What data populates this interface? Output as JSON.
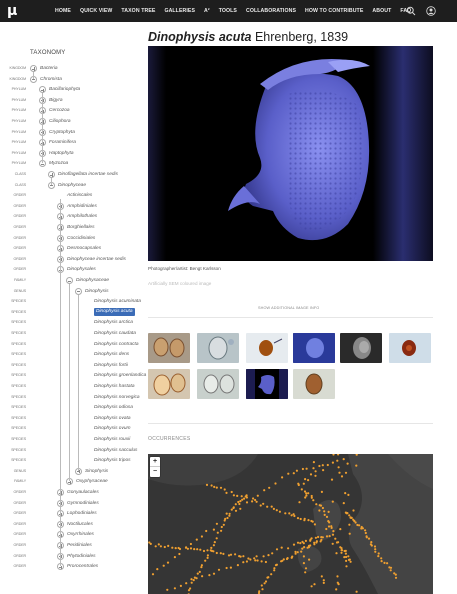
{
  "nav": {
    "logo": "μ",
    "items": [
      "HOME",
      "QUICK VIEW",
      "TAXON TREE",
      "GALLERIES",
      "A²",
      "TOOLS",
      "COLLABORATIONS",
      "HOW TO CONTRIBUTE",
      "ABOUT",
      "FAQ"
    ]
  },
  "sidebar": {
    "title": "TAXONOMY",
    "rows": [
      {
        "rank": "KINGDOM",
        "name": "Bacteria",
        "depth": 0,
        "toggle": "plus"
      },
      {
        "rank": "KINGDOM",
        "name": "Chromista",
        "depth": 0,
        "toggle": "minus"
      },
      {
        "rank": "PHYLUM",
        "name": "Bacillariophyta",
        "depth": 1,
        "toggle": "plus"
      },
      {
        "rank": "PHYLUM",
        "name": "Bigyra",
        "depth": 1,
        "toggle": "plus"
      },
      {
        "rank": "PHYLUM",
        "name": "Cercozoa",
        "depth": 1,
        "toggle": "plus"
      },
      {
        "rank": "PHYLUM",
        "name": "Ciliophora",
        "depth": 1,
        "toggle": "plus"
      },
      {
        "rank": "PHYLUM",
        "name": "Cryptophyta",
        "depth": 1,
        "toggle": "plus"
      },
      {
        "rank": "PHYLUM",
        "name": "Foraminifera",
        "depth": 1,
        "toggle": "plus"
      },
      {
        "rank": "PHYLUM",
        "name": "Haptophyta",
        "depth": 1,
        "toggle": "plus"
      },
      {
        "rank": "PHYLUM",
        "name": "Myzozoa",
        "depth": 1,
        "toggle": "minus"
      },
      {
        "rank": "CLASS",
        "name": "Dinoflagellata incertae sedis",
        "depth": 2,
        "toggle": "plus"
      },
      {
        "rank": "CLASS",
        "name": "Dinophyceae",
        "depth": 2,
        "toggle": "minus"
      },
      {
        "rank": "ORDER",
        "name": "Actiniscales",
        "depth": 3,
        "toggle": "none"
      },
      {
        "rank": "ORDER",
        "name": "Amphidiniales",
        "depth": 3,
        "toggle": "plus"
      },
      {
        "rank": "ORDER",
        "name": "Amphilothales",
        "depth": 3,
        "toggle": "plus"
      },
      {
        "rank": "ORDER",
        "name": "Borghiellales",
        "depth": 3,
        "toggle": "plus"
      },
      {
        "rank": "ORDER",
        "name": "Coccidiniales",
        "depth": 3,
        "toggle": "plus"
      },
      {
        "rank": "ORDER",
        "name": "Desmocapsales",
        "depth": 3,
        "toggle": "plus"
      },
      {
        "rank": "ORDER",
        "name": "Dinophyceae incertae sedis",
        "depth": 3,
        "toggle": "plus"
      },
      {
        "rank": "ORDER",
        "name": "Dinophysales",
        "depth": 3,
        "toggle": "minus"
      },
      {
        "rank": "FAMILY",
        "name": "Dinophysaceae",
        "depth": 4,
        "toggle": "minus"
      },
      {
        "rank": "GENUS",
        "name": "Dinophysis",
        "depth": 5,
        "toggle": "minus"
      },
      {
        "rank": "SPECIES",
        "name": "Dinophysis acuminata",
        "depth": 6,
        "toggle": "none"
      },
      {
        "rank": "SPECIES",
        "name": "Dinophysis acuta",
        "depth": 6,
        "toggle": "none",
        "selected": true
      },
      {
        "rank": "SPECIES",
        "name": "Dinophysis arctica",
        "depth": 6,
        "toggle": "none"
      },
      {
        "rank": "SPECIES",
        "name": "Dinophysis caudata",
        "depth": 6,
        "toggle": "none"
      },
      {
        "rank": "SPECIES",
        "name": "Dinophysis contracta",
        "depth": 6,
        "toggle": "none"
      },
      {
        "rank": "SPECIES",
        "name": "Dinophysis dens",
        "depth": 6,
        "toggle": "none"
      },
      {
        "rank": "SPECIES",
        "name": "Dinophysis fortii",
        "depth": 6,
        "toggle": "none"
      },
      {
        "rank": "SPECIES",
        "name": "Dinophysis groenlandica",
        "depth": 6,
        "toggle": "none"
      },
      {
        "rank": "SPECIES",
        "name": "Dinophysis hastata",
        "depth": 6,
        "toggle": "none"
      },
      {
        "rank": "SPECIES",
        "name": "Dinophysis norvegica",
        "depth": 6,
        "toggle": "none"
      },
      {
        "rank": "SPECIES",
        "name": "Dinophysis odiosa",
        "depth": 6,
        "toggle": "none"
      },
      {
        "rank": "SPECIES",
        "name": "Dinophysis ovata",
        "depth": 6,
        "toggle": "none"
      },
      {
        "rank": "SPECIES",
        "name": "Dinophysis ovum",
        "depth": 6,
        "toggle": "none"
      },
      {
        "rank": "SPECIES",
        "name": "Dinophysis rouxii",
        "depth": 6,
        "toggle": "none"
      },
      {
        "rank": "SPECIES",
        "name": "Dinophysis sacculus",
        "depth": 6,
        "toggle": "none"
      },
      {
        "rank": "SPECIES",
        "name": "Dinophysis tripos",
        "depth": 6,
        "toggle": "none"
      },
      {
        "rank": "GENUS",
        "name": "Sinophysis",
        "depth": 5,
        "toggle": "plus"
      },
      {
        "rank": "FAMILY",
        "name": "Oxyphysaceae",
        "depth": 4,
        "toggle": "plus"
      },
      {
        "rank": "ORDER",
        "name": "Gonyaulacales",
        "depth": 3,
        "toggle": "plus"
      },
      {
        "rank": "ORDER",
        "name": "Gymnodiniales",
        "depth": 3,
        "toggle": "plus"
      },
      {
        "rank": "ORDER",
        "name": "Lophodiniales",
        "depth": 3,
        "toggle": "plus"
      },
      {
        "rank": "ORDER",
        "name": "Noctilucales",
        "depth": 3,
        "toggle": "plus"
      },
      {
        "rank": "ORDER",
        "name": "Oxyrrhinales",
        "depth": 3,
        "toggle": "plus"
      },
      {
        "rank": "ORDER",
        "name": "Peridiniales",
        "depth": 3,
        "toggle": "plus"
      },
      {
        "rank": "ORDER",
        "name": "Phytodiniales",
        "depth": 3,
        "toggle": "plus"
      },
      {
        "rank": "ORDER",
        "name": "Prorocentrales",
        "depth": 3,
        "toggle": "plus"
      }
    ]
  },
  "main": {
    "title_italic": "Dinophysis acuta",
    "title_author": " Ehrenberg, 1839",
    "credit": "Photographer/artist: Bengt Karlsson",
    "caption": "Artificially SEM coloured image",
    "show_more": "SHOW ADDITIONAL IMAGE INFO",
    "occurrences_title": "OCCURRENCES",
    "zoom_in": "+",
    "zoom_out": "−"
  },
  "colors": {
    "nav_bg": "#1e1e1e",
    "selected": "#3b6cb7",
    "sem_blue": "#5a5fc9",
    "map_points": "#f0a030"
  },
  "icons": {
    "search": "search-icon",
    "user": "user-icon"
  }
}
